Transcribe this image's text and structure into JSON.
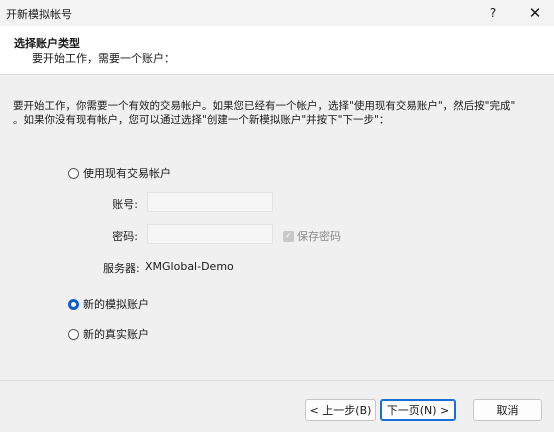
{
  "window": {
    "title": "开新模拟帐号",
    "help_label": "?",
    "close_label": "✕"
  },
  "header": {
    "title": "选择账户类型",
    "subtitle": "要开始工作，需要一个账户："
  },
  "content": {
    "intro": "要开始工作，你需要一个有效的交易帐户。如果您已经有一个帐户，选择\"使用现有交易账户\"，然后按\"完成\"\n。如果你没有现有帐户，您可以通过选择\"创建一个新模拟账户\"并按下\"下一步\"：",
    "options": {
      "existing": {
        "label": "使用现有交易帐户",
        "selected": false
      },
      "demo": {
        "label": "新的模拟账户",
        "selected": true
      },
      "real": {
        "label": "新的真实账户",
        "selected": false
      }
    },
    "login": {
      "label": "账号:",
      "value": ""
    },
    "password": {
      "label": "密码:",
      "value": ""
    },
    "save_password": {
      "label": "保存密码",
      "checked": true
    },
    "server": {
      "label": "服务器:",
      "value": "XMGlobal-Demo"
    }
  },
  "footer": {
    "back_label": "< 上一步(B)",
    "next_label": "下一页(N) >",
    "cancel_label": "取消"
  },
  "colors": {
    "accent": "#0f5bd0",
    "panel_bg": "#f0f0f0"
  }
}
